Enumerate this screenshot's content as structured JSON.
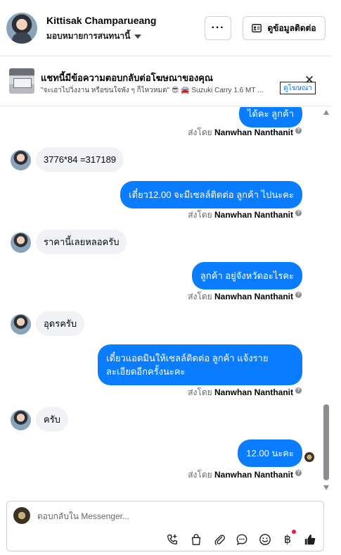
{
  "header": {
    "contact_name": "Kittisak Champarueang",
    "assignee": "มอบหมายการสนทนานี้",
    "more_label": "···",
    "contact_info_label": "ดูข้อมูลติดต่อ"
  },
  "ad": {
    "title": "แชทนี้มีข้อความตอบกลับต่อโฆษณาของคุณ",
    "subtitle": "\"จะเอาไปวิ่งงาน หรือขนใจพัง ๆ ก็ไหวหมด\" 😎 🚘 Suzuki Carry 1.6 MT ...",
    "link_label": "ดูโฆษณา",
    "close_label": "✕"
  },
  "messages": {
    "m0": "ได้คะ ลูกค้า",
    "m1": "3776*84  =317189",
    "m2": "เดี๋ยว12.00 จะมีเซลล์ติดต่อ ลูกค้า ไปนะคะ",
    "m3": "ราคานี้เลยหลอครับ",
    "m4": "ลูกค้า อยู่จังหวัดอะไรคะ",
    "m5": "อุดรครับ",
    "m6_line1": "เดี๋ยวแอดมินให้เซลล์ติดต่อ ลูกค้า แจ้งราย",
    "m6_line2": "ละเอียดอีกครั้งนะคะ",
    "m7": "ครับ",
    "m8": "12.00 นะคะ"
  },
  "sent_by": {
    "prefix": "ส่งโดย",
    "name": "Nanwhan Nanthanit"
  },
  "composer": {
    "placeholder": "ตอบกลับใน Messenger...",
    "currency_symbol": "฿"
  },
  "colors": {
    "accent": "#0a7cff",
    "incoming_bubble": "#f0f2f5",
    "notification_dot": "#e41e3f"
  },
  "icons": [
    "more-icon",
    "contact-card-icon",
    "close-icon",
    "info-icon",
    "phone-plus-icon",
    "shopping-bag-icon",
    "paperclip-icon",
    "message-bubble-icon",
    "emoji-icon",
    "baht-icon",
    "thumbs-up-icon"
  ]
}
